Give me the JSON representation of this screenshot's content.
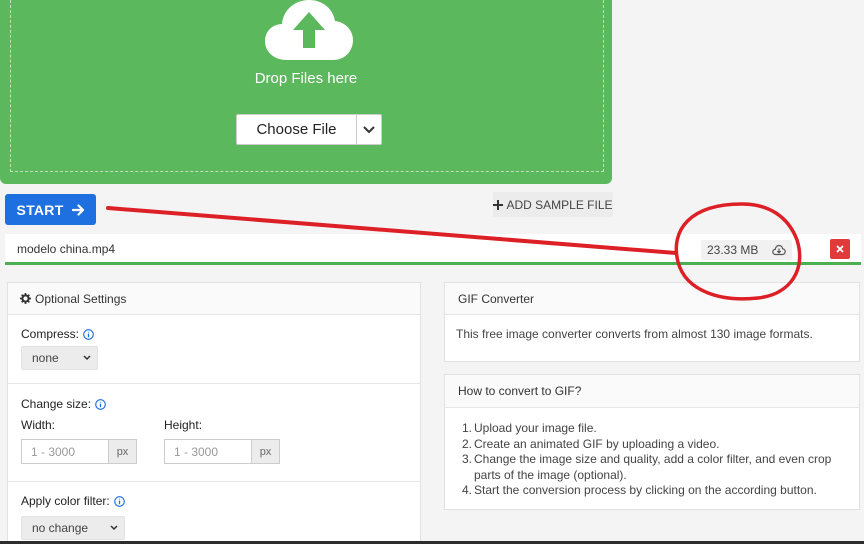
{
  "dropzone": {
    "drop_text": "Drop Files here",
    "choose_file_label": "Choose File",
    "bg_color": "#5cb85c"
  },
  "actions": {
    "start_label": "START",
    "add_sample_label": "ADD SAMPLE FILE",
    "accent_color": "#1e6fe0"
  },
  "file": {
    "name": "modelo china.mp4",
    "size": "23.33 MB",
    "progress_percent": 100,
    "progress_color": "#4cb050"
  },
  "settings": {
    "title": "Optional Settings",
    "compress": {
      "label": "Compress:",
      "value": "none"
    },
    "change_size": {
      "label": "Change size:",
      "width_label": "Width:",
      "width_placeholder": "1 - 3000",
      "height_label": "Height:",
      "height_placeholder": "1 - 3000",
      "unit": "px"
    },
    "color_filter": {
      "label": "Apply color filter:",
      "value": "no change"
    }
  },
  "converter_card": {
    "title": "GIF Converter",
    "text": "This free image converter converts from almost 130 image formats."
  },
  "howto_card": {
    "title": "How to convert to GIF?",
    "steps": [
      {
        "num": "1.",
        "text": "Upload your image file."
      },
      {
        "num": "2.",
        "text": "Create an animated GIF by uploading a video."
      },
      {
        "num": "3.",
        "text": "Change the image size and quality, add a color filter, and even crop parts of the image (optional)."
      },
      {
        "num": "4.",
        "text": "Start the conversion process by clicking on the according button."
      }
    ]
  },
  "annotation": {
    "color": "#dd1f26"
  }
}
